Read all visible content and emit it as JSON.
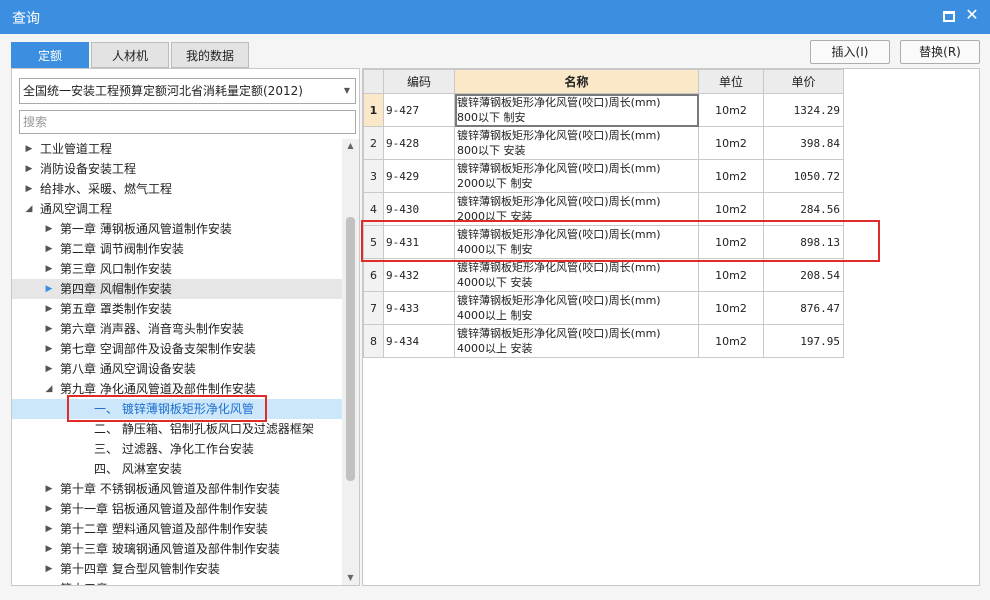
{
  "window": {
    "title": "查询"
  },
  "tabs": [
    {
      "label": "定额"
    },
    {
      "label": "人材机"
    },
    {
      "label": "我的数据"
    }
  ],
  "buttons": {
    "insert": "插入(I)",
    "replace": "替换(R)"
  },
  "library": {
    "selected": "全国统一安装工程预算定额河北省消耗量定额(2012)"
  },
  "search": {
    "placeholder": "搜索"
  },
  "tree": [
    {
      "label": "工业管道工程",
      "level": 0,
      "state": "collapsed"
    },
    {
      "label": "消防设备安装工程",
      "level": 0,
      "state": "collapsed"
    },
    {
      "label": "给排水、采暖、燃气工程",
      "level": 0,
      "state": "collapsed"
    },
    {
      "label": "通风空调工程",
      "level": 0,
      "state": "expanded"
    },
    {
      "label": "第一章 薄钢板通风管道制作安装",
      "level": 1,
      "state": "collapsed"
    },
    {
      "label": "第二章 调节阀制作安装",
      "level": 1,
      "state": "collapsed"
    },
    {
      "label": "第三章 风口制作安装",
      "level": 1,
      "state": "collapsed"
    },
    {
      "label": "第四章 风帽制作安装",
      "level": 1,
      "state": "collapsed-hot"
    },
    {
      "label": "第五章 罩类制作安装",
      "level": 1,
      "state": "collapsed"
    },
    {
      "label": "第六章 消声器、消音弯头制作安装",
      "level": 1,
      "state": "collapsed"
    },
    {
      "label": "第七章 空调部件及设备支架制作安装",
      "level": 1,
      "state": "collapsed"
    },
    {
      "label": "第八章 通风空调设备安装",
      "level": 1,
      "state": "collapsed"
    },
    {
      "label": "第九章 净化通风管道及部件制作安装",
      "level": 1,
      "state": "expanded"
    },
    {
      "label": "一、 镀锌薄钢板矩形净化风管",
      "level": 2,
      "state": "selected"
    },
    {
      "label": "二、 静压箱、铝制孔板风口及过滤器框架",
      "level": 2,
      "state": "leaf"
    },
    {
      "label": "三、 过滤器、净化工作台安装",
      "level": 2,
      "state": "leaf"
    },
    {
      "label": "四、 风淋室安装",
      "level": 2,
      "state": "leaf"
    },
    {
      "label": "第十章 不锈钢板通风管道及部件制作安装",
      "level": 1,
      "state": "collapsed"
    },
    {
      "label": "第十一章 铝板通风管道及部件制作安装",
      "level": 1,
      "state": "collapsed"
    },
    {
      "label": "第十二章 塑料通风管道及部件制作安装",
      "level": 1,
      "state": "collapsed"
    },
    {
      "label": "第十三章 玻璃钢通风管道及部件制作安装",
      "level": 1,
      "state": "collapsed"
    },
    {
      "label": "第十四章 复合型风管制作安装",
      "level": 1,
      "state": "collapsed"
    },
    {
      "label": "第十五章 ...",
      "level": 1,
      "state": "collapsed"
    }
  ],
  "table": {
    "columns": [
      "",
      "编码",
      "名称",
      "单位",
      "单价"
    ],
    "rows": [
      {
        "idx": "1",
        "code": "9-427",
        "name": [
          "镀锌薄钢板矩形净化风管(咬口)周长(mm)",
          "800以下 制安"
        ],
        "unit": "10m2",
        "price": "1324.29",
        "current": true
      },
      {
        "idx": "2",
        "code": "9-428",
        "name": [
          "镀锌薄钢板矩形净化风管(咬口)周长(mm)",
          "800以下 安装"
        ],
        "unit": "10m2",
        "price": "398.84"
      },
      {
        "idx": "3",
        "code": "9-429",
        "name": [
          "镀锌薄钢板矩形净化风管(咬口)周长(mm)",
          "2000以下 制安"
        ],
        "unit": "10m2",
        "price": "1050.72"
      },
      {
        "idx": "4",
        "code": "9-430",
        "name": [
          "镀锌薄钢板矩形净化风管(咬口)周长(mm)",
          "2000以下 安装"
        ],
        "unit": "10m2",
        "price": "284.56"
      },
      {
        "idx": "5",
        "code": "9-431",
        "name": [
          "镀锌薄钢板矩形净化风管(咬口)周长(mm)",
          "4000以下 制安"
        ],
        "unit": "10m2",
        "price": "898.13"
      },
      {
        "idx": "6",
        "code": "9-432",
        "name": [
          "镀锌薄钢板矩形净化风管(咬口)周长(mm)",
          "4000以下 安装"
        ],
        "unit": "10m2",
        "price": "208.54"
      },
      {
        "idx": "7",
        "code": "9-433",
        "name": [
          "镀锌薄钢板矩形净化风管(咬口)周长(mm)",
          "4000以上 制安"
        ],
        "unit": "10m2",
        "price": "876.47"
      },
      {
        "idx": "8",
        "code": "9-434",
        "name": [
          "镀锌薄钢板矩形净化风管(咬口)周长(mm)",
          "4000以上 安装"
        ],
        "unit": "10m2",
        "price": "197.95"
      }
    ]
  },
  "colors": {
    "titlebar": "#3c8fe0",
    "highlight_box": "#e02b2b",
    "selected_row": "#cce6fa",
    "header_accent": "#fbe8c8"
  }
}
